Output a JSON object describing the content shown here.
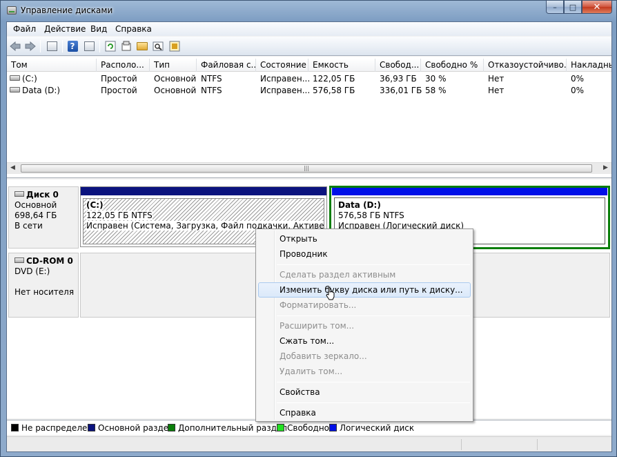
{
  "window": {
    "title": "Управление дисками",
    "caption": {
      "minimize": "–",
      "maximize": "□",
      "close": "✕"
    }
  },
  "menu": [
    "Файл",
    "Действие",
    "Вид",
    "Справка"
  ],
  "toolbar": {
    "icons": [
      "back-icon",
      "forward-icon",
      "console-tree-icon",
      "help-icon",
      "properties-icon",
      "refresh-icon",
      "export-icon",
      "open-folder-icon",
      "search-icon",
      "settings-icon"
    ]
  },
  "volumes": {
    "columns": [
      "Том",
      "Располо...",
      "Тип",
      "Файловая с...",
      "Состояние",
      "Емкость",
      "Свобод...",
      "Свободно %",
      "Отказоустойчиво...",
      "Накладны..."
    ],
    "rows": [
      [
        "(C:)",
        "Простой",
        "Основной",
        "NTFS",
        "Исправен...",
        "122,05 ГБ",
        "36,93 ГБ",
        "30 %",
        "Нет",
        "0%"
      ],
      [
        "Data (D:)",
        "Простой",
        "Основной",
        "NTFS",
        "Исправен...",
        "576,58 ГБ",
        "336,01 ГБ",
        "58 %",
        "Нет",
        "0%"
      ]
    ]
  },
  "disks": {
    "disk0": {
      "name": "Диск 0",
      "type": "Основной",
      "size": "698,64 ГБ",
      "status": "В сети",
      "part_c": {
        "name": "(C:)",
        "size": "122,05 ГБ NTFS",
        "status": "Исправен (Система, Загрузка, Файл подкачки, Активен, Авари"
      },
      "part_d": {
        "name": "Data  (D:)",
        "size": "576,58 ГБ NTFS",
        "status": "Исправен (Логический диск)"
      }
    },
    "cdrom0": {
      "name": "CD-ROM 0",
      "drive": "DVD (E:)",
      "status": "Нет носителя"
    }
  },
  "legend": [
    {
      "label": "Не распределен",
      "color": "#000000"
    },
    {
      "label": "Основной раздел",
      "color": "#0b137e"
    },
    {
      "label": "Дополнительный раздел",
      "color": "#0a7e0a"
    },
    {
      "label": "Свободно",
      "color": "#22e022"
    },
    {
      "label": "Логический диск",
      "color": "#0010e8"
    }
  ],
  "context_menu": {
    "open": "Открыть",
    "explorer": "Проводник",
    "make_active": "Сделать раздел активным",
    "change_letter": "Изменить букву диска или путь к диску...",
    "format": "Форматировать...",
    "extend": "Расширить том...",
    "shrink": "Сжать том...",
    "add_mirror": "Добавить зеркало...",
    "delete": "Удалить том...",
    "properties": "Свойства",
    "help": "Справка"
  }
}
